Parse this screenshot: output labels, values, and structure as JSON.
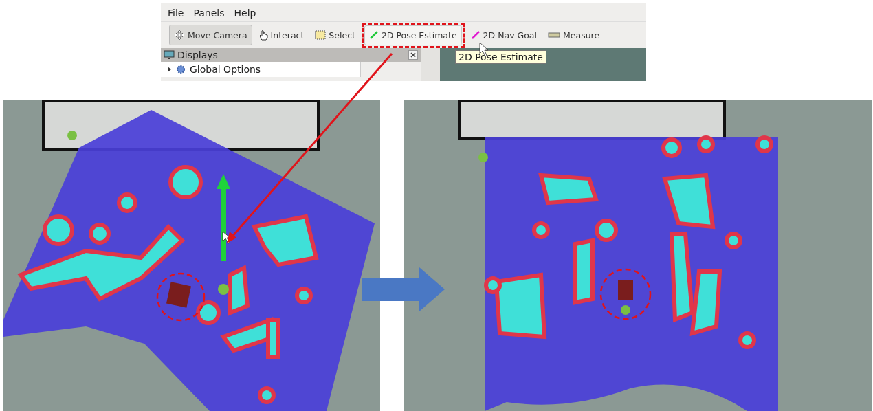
{
  "menu": [
    {
      "label": "File"
    },
    {
      "label": "Panels"
    },
    {
      "label": "Help"
    }
  ],
  "toolbar": [
    {
      "label": "Move Camera",
      "kind": "move",
      "selected": true,
      "highlighted": false
    },
    {
      "label": "Interact",
      "kind": "interact",
      "selected": false,
      "highlighted": false
    },
    {
      "label": "Select",
      "kind": "select",
      "selected": false,
      "highlighted": false
    },
    {
      "label": "2D Pose Estimate",
      "kind": "pose",
      "selected": false,
      "highlighted": true
    },
    {
      "label": "2D Nav Goal",
      "kind": "goal",
      "selected": false,
      "highlighted": false
    },
    {
      "label": "Measure",
      "kind": "measure",
      "selected": false,
      "highlighted": false
    }
  ],
  "tooltip": "2D Pose Estimate",
  "displays": {
    "title": "Displays",
    "items": [
      {
        "label": "Global Options",
        "expanded": false
      }
    ]
  }
}
